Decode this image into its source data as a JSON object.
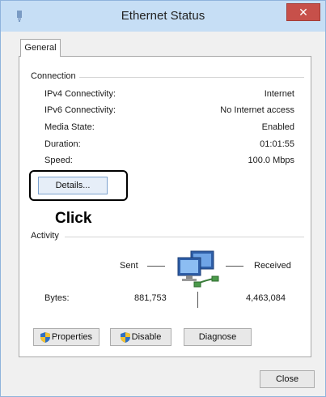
{
  "window": {
    "title": "Ethernet Status",
    "close_glyph": "✕"
  },
  "tabs": [
    {
      "label": "General"
    }
  ],
  "connection": {
    "group_label": "Connection",
    "rows": [
      {
        "label": "IPv4 Connectivity:",
        "value": "Internet"
      },
      {
        "label": "IPv6 Connectivity:",
        "value": "No Internet access"
      },
      {
        "label": "Media State:",
        "value": "Enabled"
      },
      {
        "label": "Duration:",
        "value": "01:01:55"
      },
      {
        "label": "Speed:",
        "value": "100.0 Mbps"
      }
    ],
    "details_button": "Details...",
    "annotation": "Click"
  },
  "activity": {
    "group_label": "Activity",
    "sent_label": "Sent",
    "received_label": "Received",
    "bytes_label": "Bytes:",
    "bytes_sent": "881,753",
    "bytes_received": "4,463,084",
    "icon": "network-computers-icon"
  },
  "buttons": {
    "properties": "Properties",
    "disable": "Disable",
    "diagnose": "Diagnose",
    "close": "Close"
  },
  "colors": {
    "titlebar": "#c6def5",
    "close_button": "#c7504a",
    "window_bg": "#f0f0f0",
    "shield_blue": "#2f6fc4",
    "shield_yellow": "#f2c230"
  }
}
